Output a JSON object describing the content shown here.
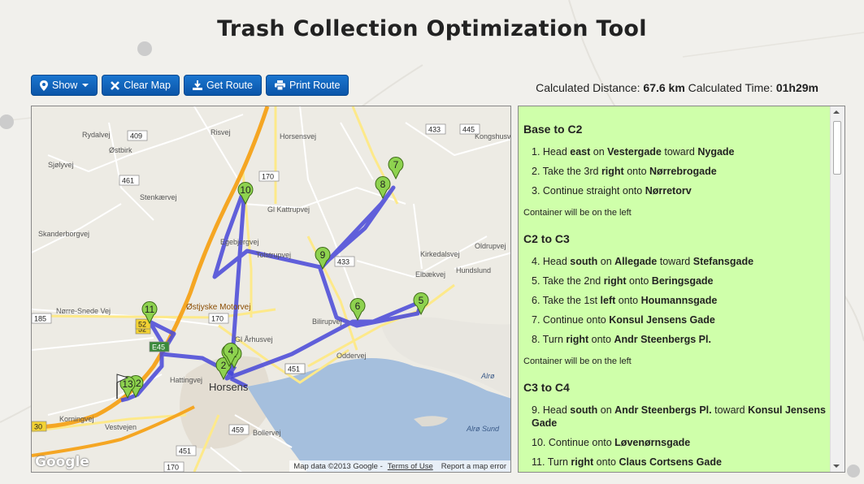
{
  "header": {
    "title": "Trash Collection Optimization Tool"
  },
  "toolbar": {
    "show_label": "Show",
    "clear_label": "Clear Map",
    "get_route_label": "Get Route",
    "print_route_label": "Print Route"
  },
  "stats": {
    "distance_label": "Calculated Distance:",
    "distance_value": "67.6 km",
    "time_label": "Calculated Time:",
    "time_value": "01h29m"
  },
  "map": {
    "attribution": "Map data ©2013 Google -",
    "terms_link": "Terms of Use",
    "report_link": "Report a map error",
    "logo": "Google",
    "city_label": "Horsens",
    "place_labels": [
      "Østbirk",
      "Hattingvej",
      "Korningvej",
      "Vestvejen",
      "Nørre-Snede Vej",
      "Bilirupvej",
      "Tolstrupvej",
      "Hundslund",
      "Alrø",
      "Alrø Sund",
      "Risvej",
      "Horsensvej",
      "Gl Kattrupvej",
      "Gl Århusvej",
      "Oddervej",
      "Kirkedalsvej",
      "Oldrupvej",
      "Bollervej",
      "Egebjergvej",
      "Østjyske Motorvej",
      "Skanderborgvej",
      "Rydalvej",
      "Stenkærvej",
      "Sjølyvej",
      "Kongshusvej",
      "Elbækvej"
    ],
    "road_numbers": [
      "409",
      "461",
      "170",
      "170",
      "433",
      "445",
      "433",
      "185",
      "52",
      "E45",
      "451",
      "459",
      "451",
      "170",
      "30",
      "52",
      "451"
    ],
    "markers": [
      "1",
      "2",
      "3",
      "4",
      "5",
      "6",
      "7",
      "8",
      "9",
      "10",
      "11",
      "12",
      "13"
    ]
  },
  "directions": [
    {
      "heading": "Base to C2",
      "steps": [
        {
          "num": "1.",
          "pre": "Head ",
          "b1": "east",
          "mid": " on ",
          "b2": "Vestergade",
          "mid2": " toward ",
          "b3": "Nygade"
        },
        {
          "num": "2.",
          "pre": "Take the 3rd ",
          "b1": "right",
          "mid": " onto ",
          "b2": "Nørrebrogade",
          "mid2": "",
          "b3": ""
        },
        {
          "num": "3.",
          "pre": "Continue straight onto ",
          "b1": "Nørretorv",
          "mid": "",
          "b2": "",
          "mid2": "",
          "b3": ""
        }
      ],
      "note": "Container will be on the left"
    },
    {
      "heading": "C2 to C3",
      "steps": [
        {
          "num": "4.",
          "pre": "Head ",
          "b1": "south",
          "mid": " on ",
          "b2": "Allegade",
          "mid2": " toward ",
          "b3": "Stefansgade"
        },
        {
          "num": "5.",
          "pre": "Take the 2nd ",
          "b1": "right",
          "mid": " onto ",
          "b2": "Beringsgade",
          "mid2": "",
          "b3": ""
        },
        {
          "num": "6.",
          "pre": "Take the 1st ",
          "b1": "left",
          "mid": " onto ",
          "b2": "Houmannsgade",
          "mid2": "",
          "b3": ""
        },
        {
          "num": "7.",
          "pre": "Continue onto ",
          "b1": "Konsul Jensens Gade",
          "mid": "",
          "b2": "",
          "mid2": "",
          "b3": ""
        },
        {
          "num": "8.",
          "pre": "Turn ",
          "b1": "right",
          "mid": " onto ",
          "b2": "Andr Steenbergs Pl.",
          "mid2": "",
          "b3": ""
        }
      ],
      "note": "Container will be on the left"
    },
    {
      "heading": "C3 to C4",
      "steps": [
        {
          "num": "9.",
          "pre": "Head ",
          "b1": "south",
          "mid": " on ",
          "b2": "Andr Steenbergs Pl.",
          "mid2": " toward ",
          "b3": "Konsul Jensens Gade"
        },
        {
          "num": "10.",
          "pre": "Continue onto ",
          "b1": "Løvenørnsgade",
          "mid": "",
          "b2": "",
          "mid2": "",
          "b3": ""
        },
        {
          "num": "11.",
          "pre": "Turn ",
          "b1": "right",
          "mid": " onto ",
          "b2": "Claus Cortsens Gade",
          "mid2": "",
          "b3": ""
        }
      ],
      "note": ""
    }
  ],
  "colors": {
    "button": "#0b55a8",
    "route": "#4646d8",
    "marker": "#8ed24f",
    "panel": "#cfffaa",
    "water": "#a5bfdd",
    "motorway": "#f5a623"
  }
}
